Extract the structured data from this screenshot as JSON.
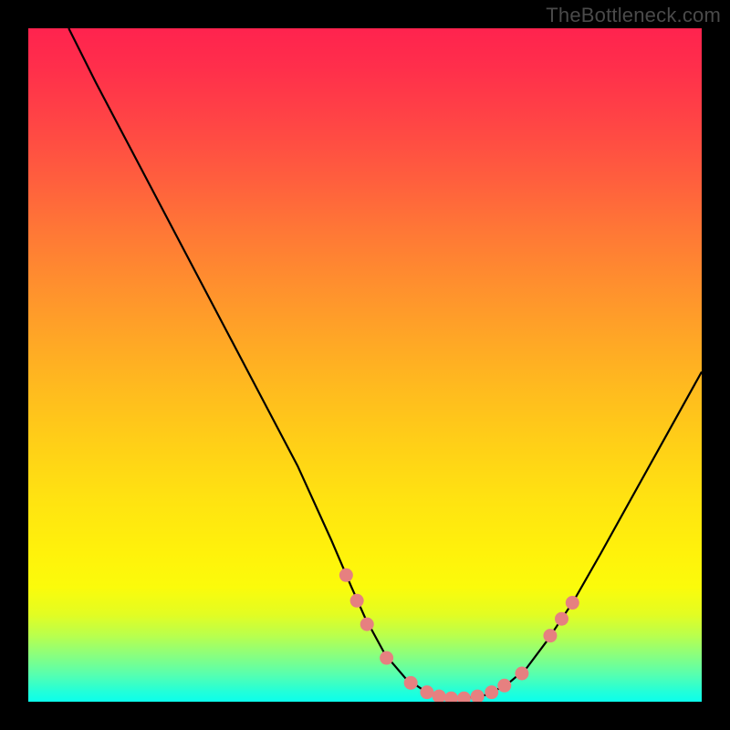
{
  "watermark": "TheBottleneck.com",
  "chart_data": {
    "type": "line",
    "title": "",
    "xlabel": "",
    "ylabel": "",
    "xlim": [
      0,
      100
    ],
    "ylim": [
      0,
      100
    ],
    "grid": false,
    "legend": false,
    "background": "rainbow-vertical-gradient",
    "series": [
      {
        "name": "bottleneck-curve",
        "color": "#000000",
        "x": [
          6.0,
          10.0,
          15.0,
          20.0,
          25.0,
          30.0,
          35.0,
          40.0,
          45.0,
          48.0,
          50.0,
          53.0,
          56.0,
          59.0,
          62.0,
          65.0,
          68.0,
          71.0,
          74.0,
          77.0,
          81.0,
          85.0,
          90.0,
          95.0,
          100.0
        ],
        "y": [
          100.0,
          92.0,
          82.5,
          73.0,
          63.5,
          54.0,
          44.5,
          35.0,
          24.0,
          17.0,
          12.5,
          7.0,
          3.5,
          1.5,
          0.5,
          0.5,
          1.0,
          2.5,
          5.0,
          9.0,
          15.0,
          22.0,
          31.0,
          40.0,
          49.0
        ]
      }
    ],
    "markers": {
      "name": "highlight-points",
      "color": "#e68080",
      "radius": 7.5,
      "points": [
        {
          "x": 47.2,
          "y": 18.8
        },
        {
          "x": 48.8,
          "y": 15.0
        },
        {
          "x": 50.3,
          "y": 11.5
        },
        {
          "x": 53.2,
          "y": 6.5
        },
        {
          "x": 56.8,
          "y": 2.8
        },
        {
          "x": 59.2,
          "y": 1.4
        },
        {
          "x": 61.0,
          "y": 0.8
        },
        {
          "x": 62.8,
          "y": 0.5
        },
        {
          "x": 64.7,
          "y": 0.5
        },
        {
          "x": 66.7,
          "y": 0.8
        },
        {
          "x": 68.8,
          "y": 1.4
        },
        {
          "x": 70.7,
          "y": 2.4
        },
        {
          "x": 73.3,
          "y": 4.2
        },
        {
          "x": 77.5,
          "y": 9.8
        },
        {
          "x": 79.2,
          "y": 12.3
        },
        {
          "x": 80.8,
          "y": 14.7
        }
      ]
    }
  }
}
